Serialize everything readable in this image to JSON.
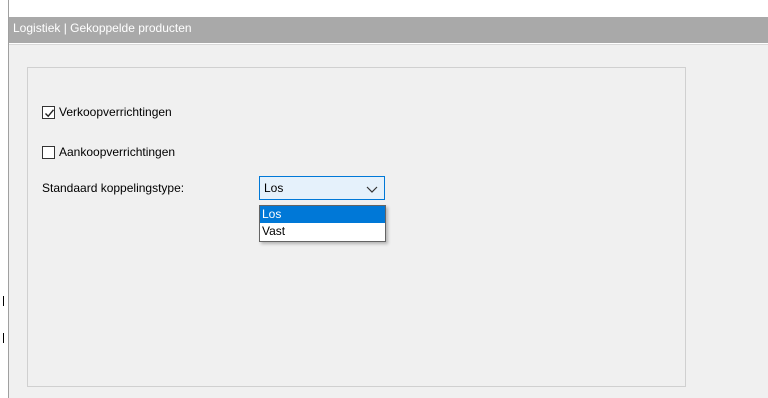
{
  "window": {
    "title": "Logistiek | Gekoppelde producten"
  },
  "options": {
    "sales": {
      "label": "Verkoopverrichtingen",
      "checked": true
    },
    "purchase": {
      "label": "Aankoopverrichtingen",
      "checked": false
    }
  },
  "link_type": {
    "label": "Standaard koppelingstype:",
    "selected": "Los",
    "options": [
      "Los",
      "Vast"
    ]
  },
  "icons": {
    "check": "check-icon",
    "dropdown": "chevron-down-icon"
  },
  "colors": {
    "title_strip": "#a9a9a9",
    "accent": "#0078d7",
    "combo_hover_bg": "#e5f1fb",
    "window_bg": "#f0f0f0"
  }
}
